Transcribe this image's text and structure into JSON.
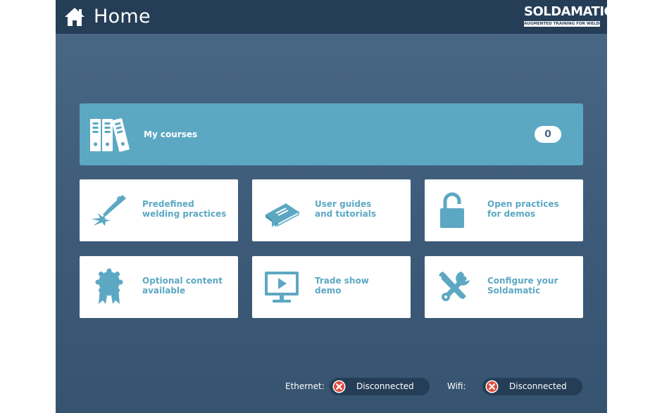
{
  "header": {
    "title": "Home",
    "home_icon": "home-icon",
    "logo": {
      "wordmark": "SOLDAMATIC",
      "tagline": "AUGMENTED TRAINING FOR WELDING"
    }
  },
  "courses": {
    "label": "My courses",
    "count": "0",
    "icon": "binders-icon"
  },
  "tiles": [
    {
      "label": "Predefined\nwelding practices",
      "icon": "welding-torch-icon"
    },
    {
      "label": "User guides\nand tutorials",
      "icon": "book-icon"
    },
    {
      "label": "Open practices\nfor demos",
      "icon": "unlocked-padlock-icon"
    },
    {
      "label": "Optional content\navailable",
      "icon": "award-ribbon-icon"
    },
    {
      "label": "Trade show\ndemo",
      "icon": "monitor-play-icon"
    },
    {
      "label": "Configure your\nSoldamatic",
      "icon": "tools-icon"
    }
  ],
  "status": {
    "ethernet": {
      "label": "Ethernet:",
      "state": "Disconnected"
    },
    "wifi": {
      "label": "Wifi:",
      "state": "Disconnected"
    }
  },
  "colors": {
    "header_bg": "#253d57",
    "background": "#456482",
    "accent": "#5ca8c3",
    "tile_bg": "#ffffff",
    "error": "#e04a3a"
  }
}
